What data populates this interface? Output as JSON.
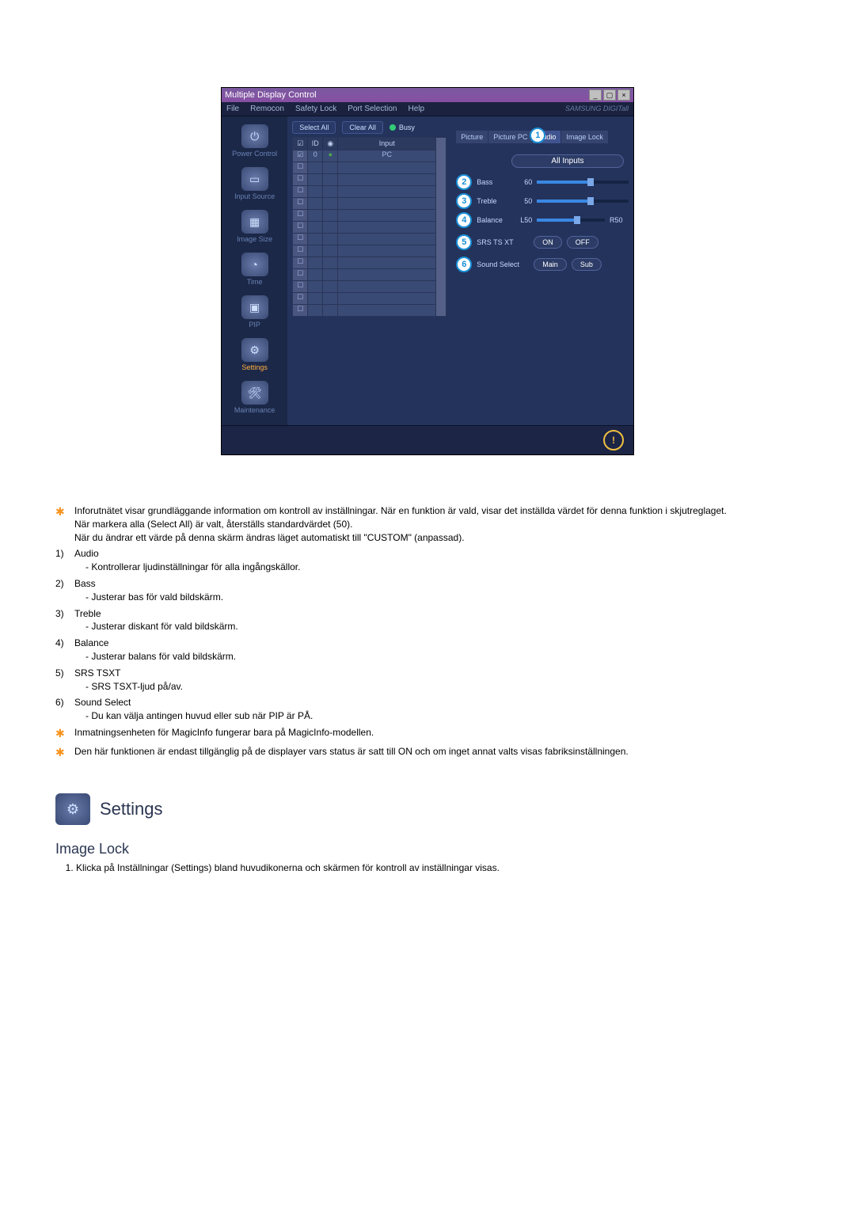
{
  "app": {
    "title": "Multiple Display Control",
    "menu": [
      "File",
      "Remocon",
      "Safety Lock",
      "Port Selection",
      "Help"
    ],
    "brand": "SAMSUNG DIGITall"
  },
  "sidebar": [
    {
      "label": "Power Control",
      "glyph": "⏻"
    },
    {
      "label": "Input Source",
      "glyph": "▭"
    },
    {
      "label": "Image Size",
      "glyph": "▦"
    },
    {
      "label": "Time",
      "glyph": "◔"
    },
    {
      "label": "PIP",
      "glyph": "▣"
    },
    {
      "label": "Settings",
      "glyph": "⚙",
      "selected": true
    },
    {
      "label": "Maintenance",
      "glyph": "🛠"
    }
  ],
  "center": {
    "select_all": "Select All",
    "clear_all": "Clear All",
    "busy": "Busy",
    "headers": {
      "id": "ID",
      "input": "Input"
    },
    "first_row": {
      "id": "0",
      "lamp": "●",
      "input": "PC"
    }
  },
  "tabs": [
    "Picture",
    "Picture PC",
    "Audio",
    "Image Lock"
  ],
  "active_tab": 2,
  "callouts": {
    "audio": "1",
    "bass": "2",
    "treble": "3",
    "balance": "4",
    "srs": "5",
    "sound": "6"
  },
  "audio": {
    "all_inputs": "All Inputs",
    "bass_label": "Bass",
    "bass_value": "60",
    "treble_label": "Treble",
    "treble_value": "50",
    "balance_label": "Balance",
    "balance_l": "L50",
    "balance_r": "R50",
    "srs_label": "SRS TS XT",
    "on": "ON",
    "off": "OFF",
    "sound_label": "Sound Select",
    "main": "Main",
    "sub": "Sub"
  },
  "doc": {
    "star1_l1": "Inforutnätet visar grundläggande information om kontroll av inställningar. När en funktion är vald, visar det inställda värdet för denna funktion i skjutreglaget.",
    "star1_l2": "När markera alla (Select All) är valt, återställs standardvärdet (50).",
    "star1_l3": "När du ändrar ett värde på denna skärm ändras läget automatiskt till \"CUSTOM\" (anpassad).",
    "items": [
      {
        "num": "1)",
        "title": "Audio",
        "desc": "- Kontrollerar ljudinställningar för alla ingångskällor."
      },
      {
        "num": "2)",
        "title": "Bass",
        "desc": "- Justerar bas för vald bildskärm."
      },
      {
        "num": "3)",
        "title": "Treble",
        "desc": "- Justerar diskant för vald bildskärm."
      },
      {
        "num": "4)",
        "title": "Balance",
        "desc": "- Justerar balans för vald bildskärm."
      },
      {
        "num": "5)",
        "title": "SRS TSXT",
        "desc": "- SRS TSXT-ljud på/av."
      },
      {
        "num": "6)",
        "title": "Sound Select",
        "desc": "- Du kan välja antingen huvud eller sub när PIP är PÅ."
      }
    ],
    "star2": "Inmatningsenheten för MagicInfo fungerar bara på MagicInfo-modellen.",
    "star3": "Den här funktionen är endast tillgänglig på de displayer vars status är satt till ON och om inget annat valts visas fabriksinställningen.",
    "section_title": "Settings",
    "subhead": "Image Lock",
    "step1": "Klicka på Inställningar (Settings) bland huvudikonerna och skärmen för kontroll av inställningar visas."
  }
}
